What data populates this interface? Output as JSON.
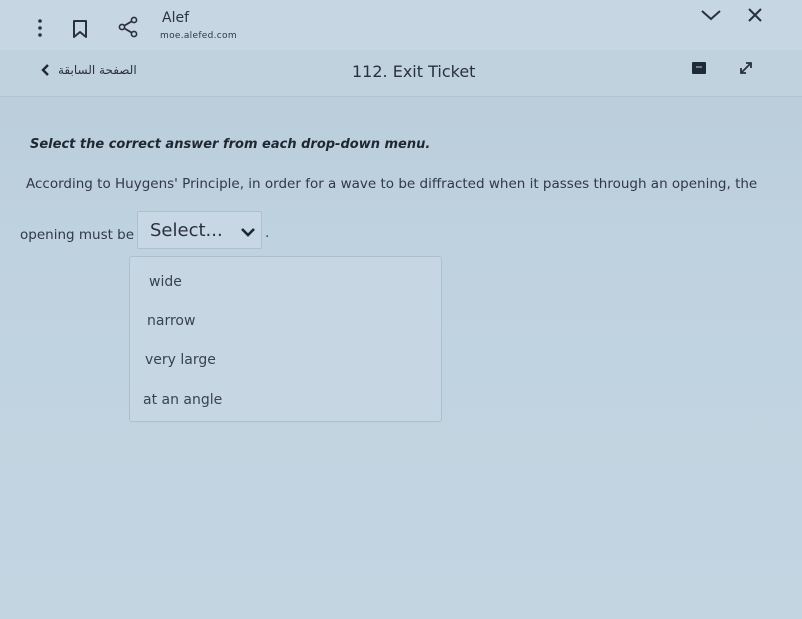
{
  "browser": {
    "site_title": "Alef",
    "url": "moe.alefed.com"
  },
  "header": {
    "back_label": "الصفحة السابقة",
    "title": "112. Exit Ticket"
  },
  "question": {
    "instruction": "Select the correct answer from each drop-down menu.",
    "line1": "According to Huygens' Principle, in order for a wave to be diffracted when it passes through an opening, the",
    "line2": "opening must be",
    "end_punct": ".",
    "select_value": "Select...",
    "options": [
      "wide",
      "narrow",
      "very large",
      "at an angle"
    ]
  }
}
